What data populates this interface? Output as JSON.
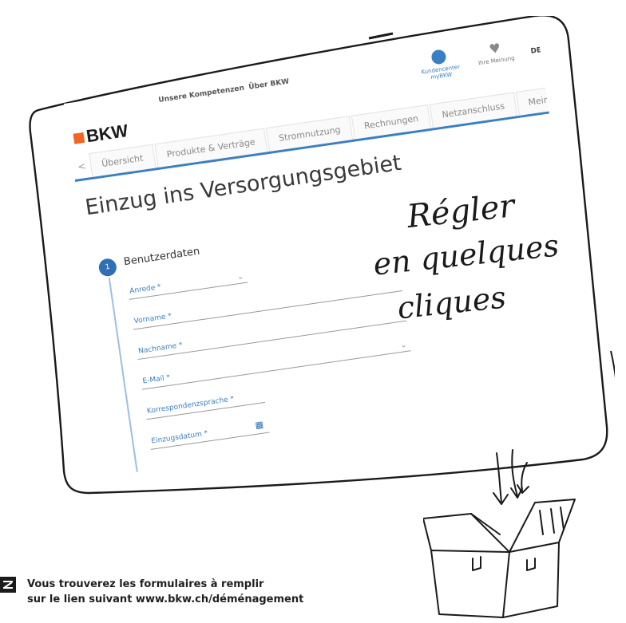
{
  "header": {
    "brand": "BKW",
    "nav": [
      "Unsere Kompetenzen",
      "Über BKW"
    ],
    "utility": [
      {
        "label": "Kundencenter myBKW",
        "icon": "user-circle-icon"
      },
      {
        "label": "Ihre Meinung",
        "icon": "heart-icon"
      }
    ],
    "language": "DE"
  },
  "tabs": {
    "prev_arrow": "<",
    "items": [
      "Übersicht",
      "Produkte & Verträge",
      "Stromnutzung",
      "Rechnungen",
      "Netzanschluss",
      "Mein"
    ],
    "next_arrow": ">"
  },
  "page_title": "Einzug ins Versorgungsgebiet",
  "step": {
    "number": "1",
    "label": "Benutzerdaten"
  },
  "form_fields": [
    {
      "label": "Anrede *",
      "control": "dropdown"
    },
    {
      "label": "Vorname *",
      "control": "text"
    },
    {
      "label": "Nachname *",
      "control": "text"
    },
    {
      "label": "E-Mail *",
      "control": "text"
    },
    {
      "label": "Korrespondenzsprache *",
      "control": "dropdown"
    },
    {
      "label": "Einzugsdatum *",
      "control": "date"
    }
  ],
  "handwriting": {
    "line1": "Régler",
    "line2": "en quelques",
    "line3": "cliques"
  },
  "footer": {
    "line1": "Vous trouverez les formulaires à remplir",
    "line2": "sur le lien suivant www.bkw.ch/déménagement"
  },
  "colors": {
    "brand_orange": "#f26522",
    "accent_blue": "#3a7fc2",
    "text_dark": "#1f1f1f"
  }
}
